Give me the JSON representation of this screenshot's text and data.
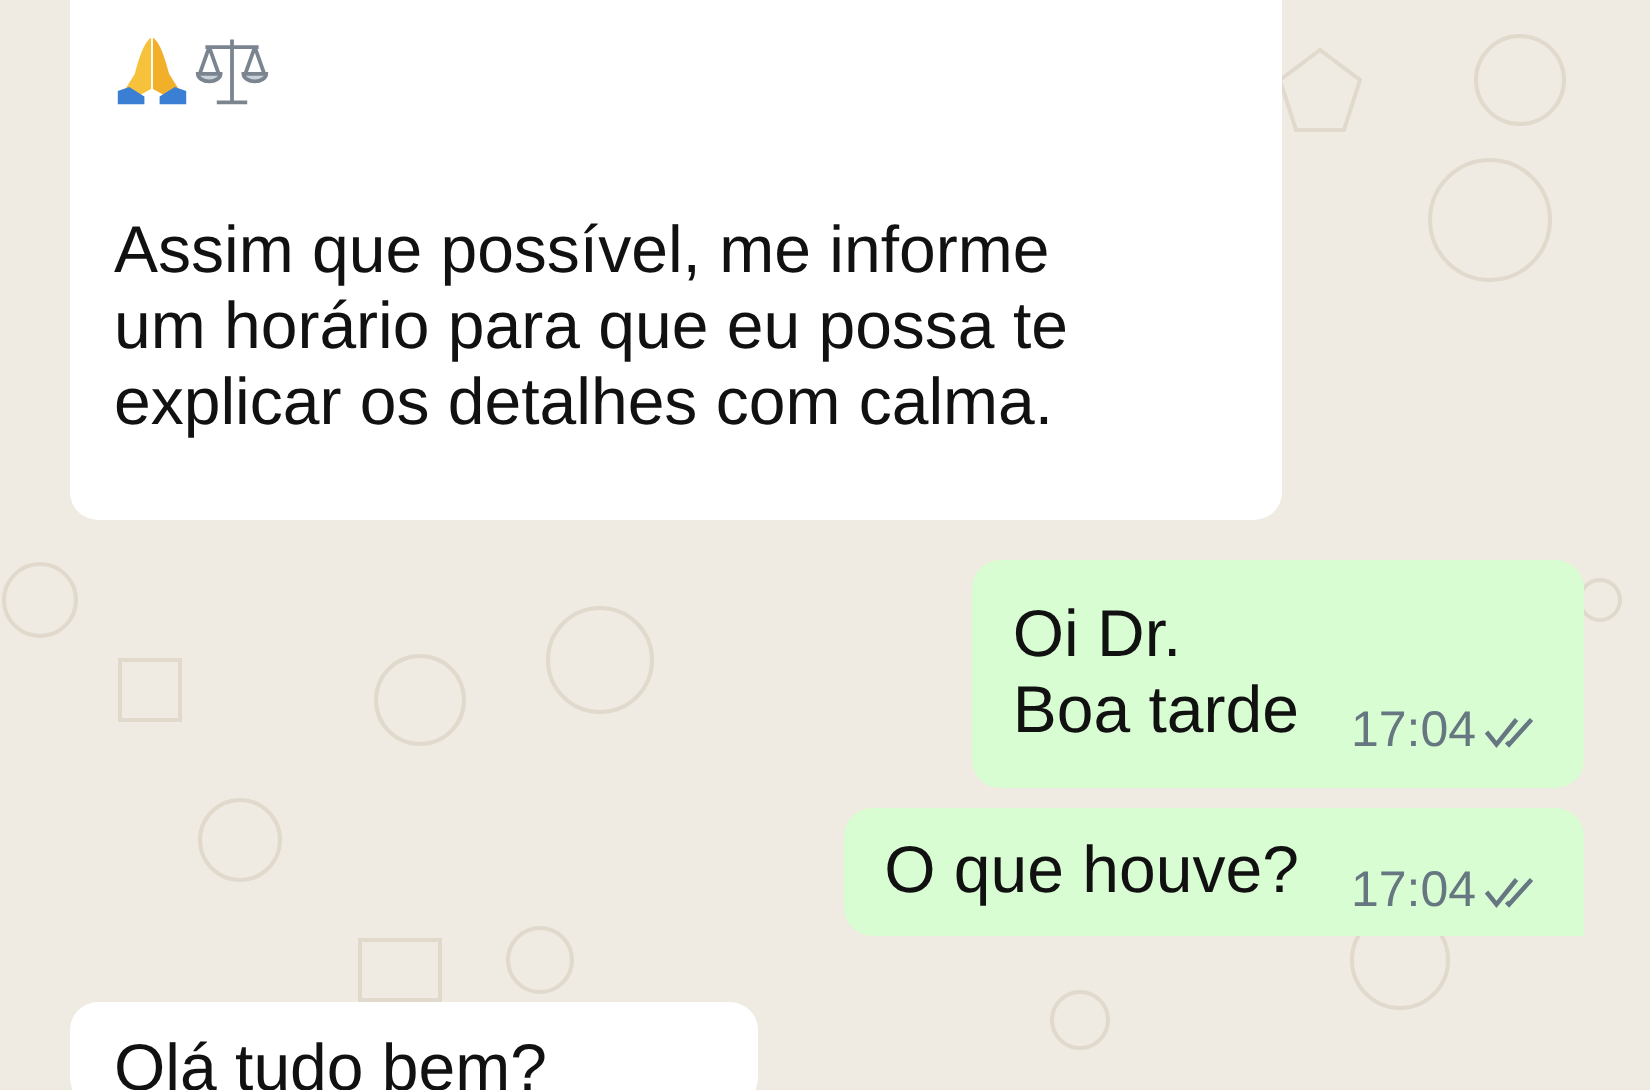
{
  "messages": [
    {
      "kind": "incoming",
      "emoji_row": true,
      "lines": [
        "Assim que possível, me informe",
        "um horário para que eu possa te",
        "explicar os detalhes com calma."
      ]
    },
    {
      "kind": "outgoing",
      "lines": [
        "Oi Dr.",
        "Boa tarde"
      ],
      "time": "17:04",
      "read": false,
      "tail": false
    },
    {
      "kind": "outgoing",
      "lines": [
        "O que houve?"
      ],
      "time": "17:04",
      "read": false,
      "tail": true
    },
    {
      "kind": "incoming",
      "emoji_row": false,
      "lines": [
        "Olá tudo bem?"
      ]
    }
  ]
}
